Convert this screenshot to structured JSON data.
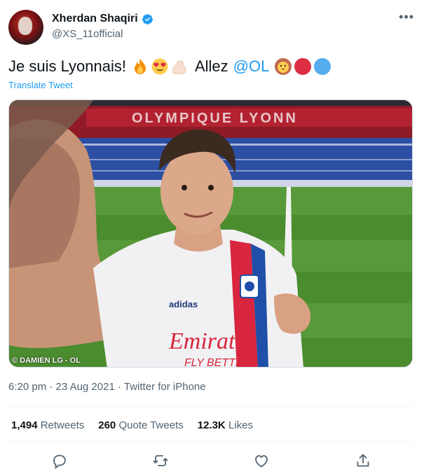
{
  "author": {
    "display_name": "Xherdan Shaqiri",
    "handle": "@XS_11official",
    "verified": true
  },
  "tweet": {
    "text_part1": "Je suis Lyonnais!",
    "emojis_part1": [
      "fire-emoji",
      "heart-eyes-emoji",
      "flexed-biceps-emoji"
    ],
    "text_part2": "Allez",
    "mention": "@OL",
    "emojis_part2": [
      "lion-emoji",
      "red-circle-emoji",
      "blue-circle-emoji"
    ],
    "translate_label": "Translate Tweet"
  },
  "media": {
    "stadium_sign": "OLYMPIQUE LYONN",
    "shirt_sponsor": "Emirates",
    "shirt_sponsor_line2": "FLY BETTER",
    "shirt_brand": "adidas",
    "credit": "© DAMIEN LG - OL"
  },
  "meta": {
    "time": "6:20 pm",
    "date": "23 Aug 2021",
    "source": "Twitter for iPhone",
    "separator": "·"
  },
  "stats": {
    "retweets_count": "1,494",
    "retweets_label": "Retweets",
    "quotes_count": "260",
    "quotes_label": "Quote Tweets",
    "likes_count": "12.3K",
    "likes_label": "Likes"
  },
  "colors": {
    "link": "#1d9bf0",
    "muted": "#536471",
    "text": "#0f1419"
  }
}
